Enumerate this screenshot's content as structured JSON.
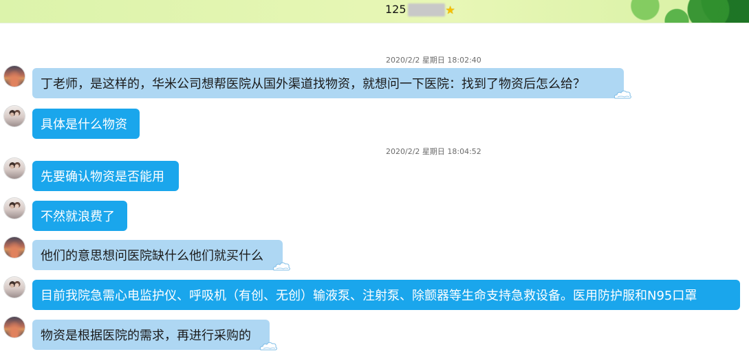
{
  "window": {
    "title_prefix": "125",
    "star_icon": "star-icon"
  },
  "colors": {
    "titlebar": "#dcf3ab",
    "bubble_incoming": "#aed7f3",
    "bubble_outgoing": "#1aa6ec",
    "timestamp": "#6b6b6b"
  },
  "chat": {
    "timestamps": [
      "2020/2/2 星期日 18:02:40",
      "2020/2/2 星期日 18:04:52"
    ],
    "messages": [
      {
        "avatar": "sunset-avatar",
        "text": "丁老师，是这样的，华米公司想帮医院从国外渠道找物资，就想问一下医院：找到了物资后怎么给？"
      },
      {
        "avatar": "photo-avatar",
        "text": "具体是什么物资"
      },
      {
        "avatar": "photo-avatar",
        "text": "先要确认物资是否能用"
      },
      {
        "avatar": "photo-avatar",
        "text": "不然就浪费了"
      },
      {
        "avatar": "sunset-avatar",
        "text": "他们的意思想问医院缺什么他们就买什么"
      },
      {
        "avatar": "photo-avatar",
        "text": "目前我院急需心电监护仪、呼吸机（有创、无创）输液泵、注射泵、除颤器等生命支持急救设备。医用防护服和N95口罩"
      },
      {
        "avatar": "sunset-avatar",
        "text": "物资是根据医院的需求，再进行采购的"
      }
    ]
  }
}
